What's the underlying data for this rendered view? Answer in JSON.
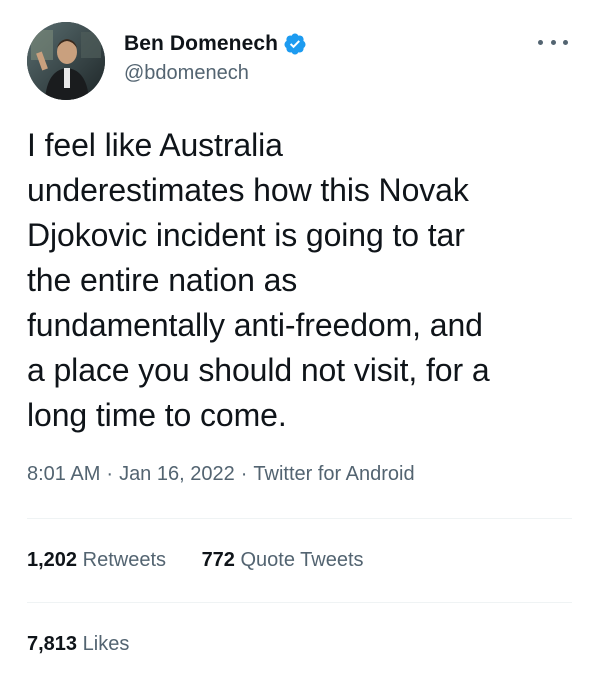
{
  "user": {
    "display_name": "Ben Domenech",
    "handle": "@bdomenech",
    "verified_color": "#1d9bf0"
  },
  "tweet": {
    "text": "I feel like Australia\nunderestimates how this Novak\nDjokovic incident is going to tar\nthe entire nation as\nfundamentally anti-freedom, and\na place you should not visit, for a\nlong time to come.",
    "time": "8:01 AM",
    "date": "Jan 16, 2022",
    "source": "Twitter for Android",
    "separator": "·"
  },
  "stats": {
    "retweets_count": "1,202",
    "retweets_label": "Retweets",
    "quotes_count": "772",
    "quotes_label": "Quote Tweets",
    "likes_count": "7,813",
    "likes_label": "Likes"
  },
  "icons": {
    "verified": "verified-badge-icon",
    "more": "more-options-icon"
  }
}
